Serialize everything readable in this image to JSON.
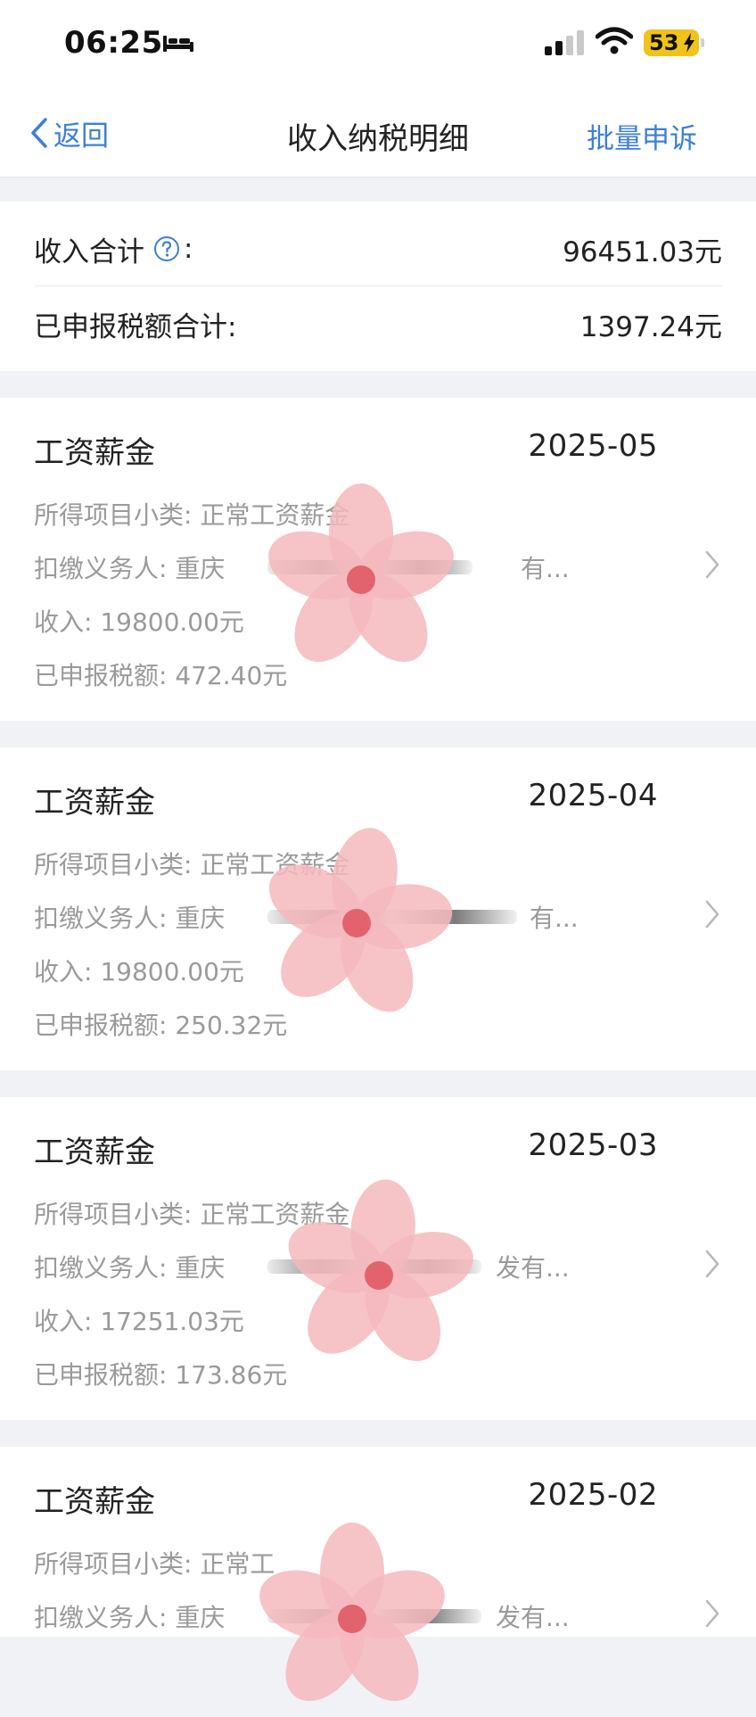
{
  "status_bar": {
    "time": "06:25",
    "battery": "53"
  },
  "nav": {
    "back_label": "返回",
    "title": "收入纳税明细",
    "appeal_label": "批量申诉"
  },
  "summary": {
    "income_label": "收入合计",
    "income_value": "96451.03元",
    "tax_label": "已申报税额合计:",
    "tax_value": "1397.24元"
  },
  "records": [
    {
      "type": "工资薪金",
      "date": "2025-05",
      "subcategory": "所得项目小类: 正常工资薪金",
      "withholder_prefix": "扣缴义务人: 重庆",
      "withholder_suffix": "有...",
      "income": "收入: 19800.00元",
      "tax": "已申报税额: 472.40元"
    },
    {
      "type": "工资薪金",
      "date": "2025-04",
      "subcategory": "所得项目小类: 正常工资薪金",
      "withholder_prefix": "扣缴义务人: 重庆",
      "withholder_suffix": "有...",
      "income": "收入: 19800.00元",
      "tax": "已申报税额: 250.32元"
    },
    {
      "type": "工资薪金",
      "date": "2025-03",
      "subcategory": "所得项目小类: 正常工资薪金",
      "withholder_prefix": "扣缴义务人: 重庆",
      "withholder_suffix": "发有...",
      "income": "收入: 17251.03元",
      "tax": "已申报税额: 173.86元"
    },
    {
      "type": "工资薪金",
      "date": "2025-02",
      "subcategory": "所得项目小类: 正常工",
      "withholder_prefix": "扣缴义务人: 重庆",
      "withholder_suffix": "发有...",
      "income": "",
      "tax": ""
    }
  ],
  "colors": {
    "accent": "#3d7fd6",
    "battery": "#f1c21b",
    "sticker": "#f5b8bd"
  }
}
